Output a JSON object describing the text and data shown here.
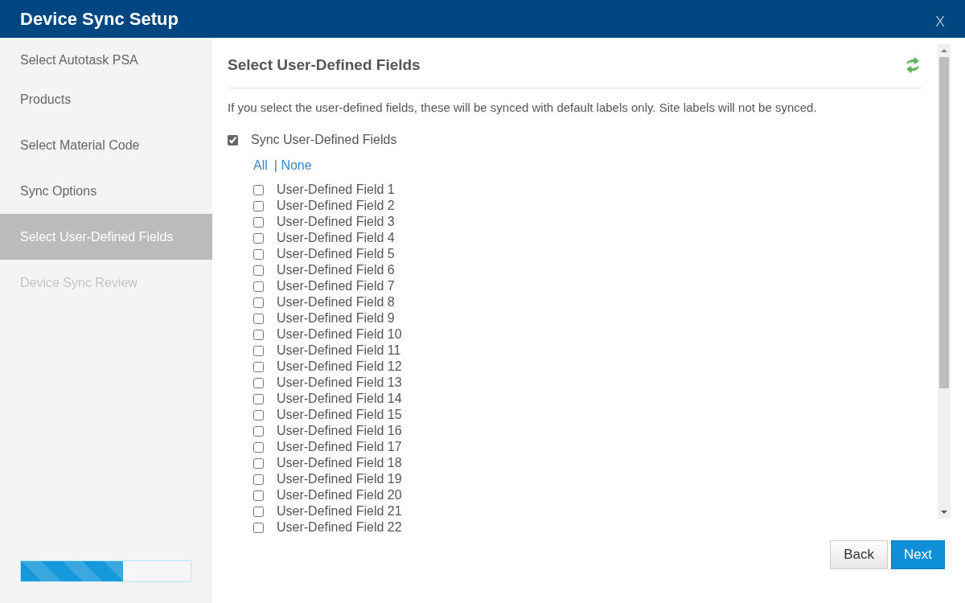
{
  "window": {
    "title": "Device Sync Setup",
    "close": "X"
  },
  "sidebar": {
    "items": [
      {
        "label": "Select Autotask PSA",
        "selected": false,
        "disabled": false
      },
      {
        "label": "Products",
        "selected": false,
        "disabled": false
      },
      {
        "label": "Select Material Code",
        "selected": false,
        "disabled": false
      },
      {
        "label": "Sync Options",
        "selected": false,
        "disabled": false
      },
      {
        "label": "Select User-Defined Fields",
        "selected": true,
        "disabled": false
      },
      {
        "label": "Device Sync Review",
        "selected": false,
        "disabled": true
      }
    ],
    "progress": {
      "level": 0.6
    }
  },
  "content": {
    "title": "Select User-Defined Fields",
    "description": "If you select the user-defined fields, these will be synced with default labels only. Site labels will not be synced.",
    "sync_checkbox": {
      "label": "Sync User-Defined Fields",
      "checked": true
    },
    "select_links": [
      {
        "label": "All"
      },
      {
        "label": "| None"
      }
    ],
    "fields": [
      {
        "label": "User-Defined Field 1",
        "checked": false
      },
      {
        "label": "User-Defined Field 2",
        "checked": false
      },
      {
        "label": "User-Defined Field 3",
        "checked": false
      },
      {
        "label": "User-Defined Field 4",
        "checked": false
      },
      {
        "label": "User-Defined Field 5",
        "checked": false
      },
      {
        "label": "User-Defined Field 6",
        "checked": false
      },
      {
        "label": "User-Defined Field 7",
        "checked": false
      },
      {
        "label": "User-Defined Field 8",
        "checked": false
      },
      {
        "label": "User-Defined Field 9",
        "checked": false
      },
      {
        "label": "User-Defined Field 10",
        "checked": false
      },
      {
        "label": "User-Defined Field 11",
        "checked": false
      },
      {
        "label": "User-Defined Field 12",
        "checked": false
      },
      {
        "label": "User-Defined Field 13",
        "checked": false
      },
      {
        "label": "User-Defined Field 14",
        "checked": false
      },
      {
        "label": "User-Defined Field 15",
        "checked": false
      },
      {
        "label": "User-Defined Field 16",
        "checked": false
      },
      {
        "label": "User-Defined Field 17",
        "checked": false
      },
      {
        "label": "User-Defined Field 18",
        "checked": false
      },
      {
        "label": "User-Defined Field 19",
        "checked": false
      },
      {
        "label": "User-Defined Field 20",
        "checked": false
      },
      {
        "label": "User-Defined Field 21",
        "checked": false
      },
      {
        "label": "User-Defined Field 22",
        "checked": false
      }
    ]
  },
  "buttons": [
    {
      "label": "Back",
      "kind": "secondary"
    },
    {
      "label": "Next",
      "kind": "primary"
    }
  ]
}
